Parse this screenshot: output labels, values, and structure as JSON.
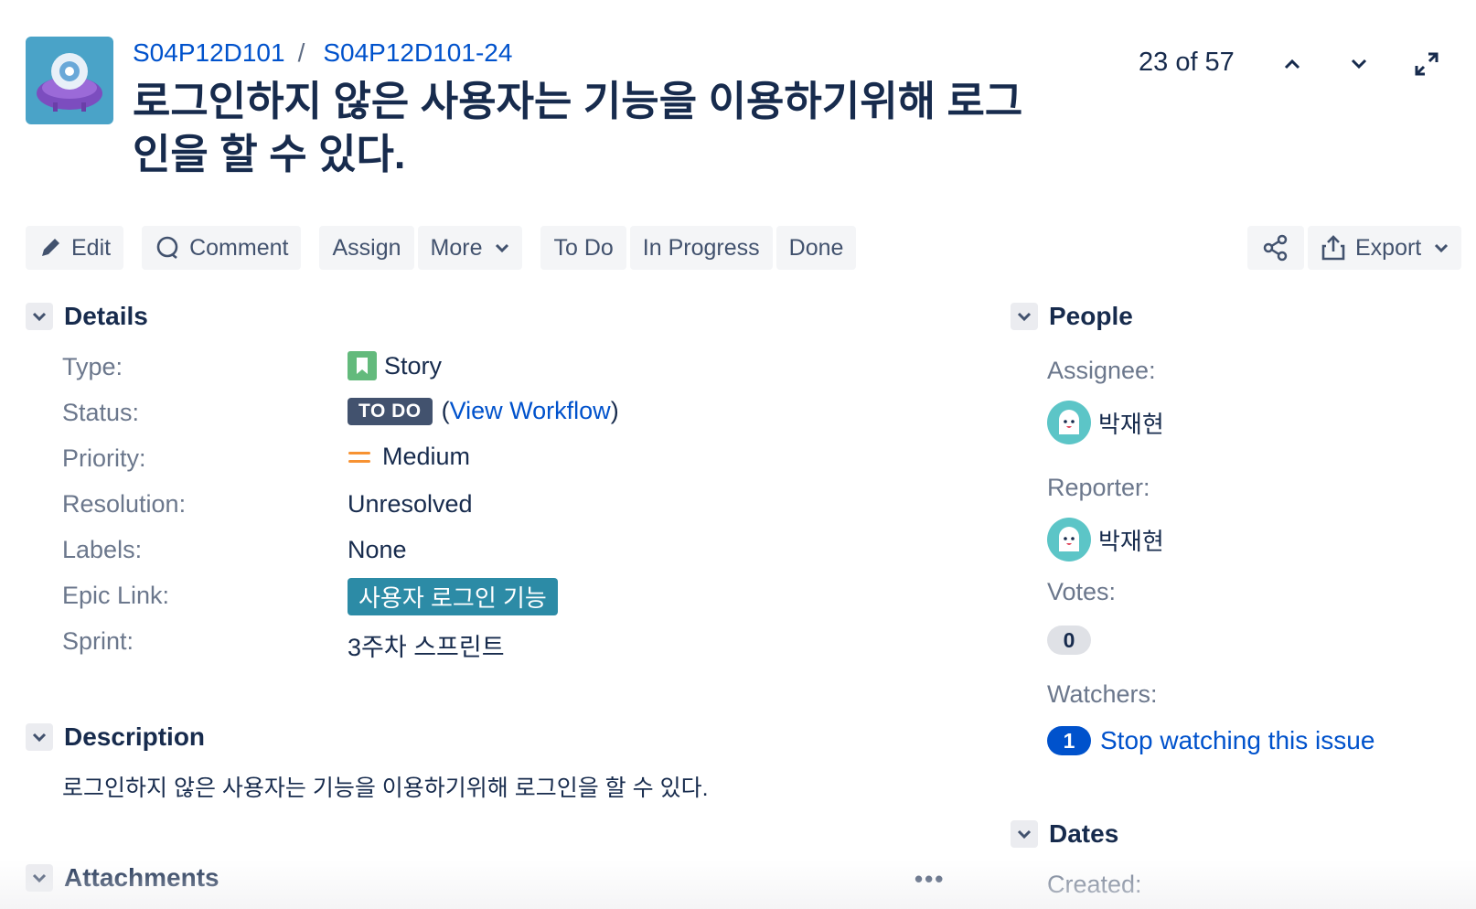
{
  "breadcrumb": {
    "project_key": "S04P12D101",
    "separator": "/",
    "issue_key": "S04P12D101-24"
  },
  "summary": "로그인하지 않은 사용자는 기능을 이용하기위해 로그인을 할 수 있다.",
  "pager": {
    "text": "23 of 57"
  },
  "toolbar": {
    "edit": "Edit",
    "comment": "Comment",
    "assign": "Assign",
    "more": "More",
    "todo": "To Do",
    "in_progress": "In Progress",
    "done": "Done",
    "export": "Export"
  },
  "details": {
    "heading": "Details",
    "fields": {
      "type": {
        "label": "Type:",
        "value": "Story"
      },
      "status": {
        "label": "Status:",
        "value": "TO DO",
        "open_paren": "(",
        "link": "View Workflow",
        "close_paren": ")"
      },
      "priority": {
        "label": "Priority:",
        "value": "Medium"
      },
      "resolution": {
        "label": "Resolution:",
        "value": "Unresolved"
      },
      "labels": {
        "label": "Labels:",
        "value": "None"
      },
      "epic_link": {
        "label": "Epic Link:",
        "value": "사용자 로그인 기능"
      },
      "sprint": {
        "label": "Sprint:",
        "value": "3주차 스프린트"
      }
    }
  },
  "description": {
    "heading": "Description",
    "text": "로그인하지 않은 사용자는 기능을 이용하기위해 로그인을 할 수 있다."
  },
  "attachments": {
    "heading": "Attachments",
    "more": "•••"
  },
  "people": {
    "heading": "People",
    "assignee_label": "Assignee:",
    "assignee": "박재현",
    "reporter_label": "Reporter:",
    "reporter": "박재현",
    "votes_label": "Votes:",
    "votes": "0",
    "watchers_label": "Watchers:",
    "watchers": "1",
    "watch_link": "Stop watching this issue"
  },
  "dates": {
    "heading": "Dates",
    "created_label": "Created:"
  },
  "colors": {
    "link": "#0052cc",
    "status_todo": "#42526e",
    "epic": "#2c8ba6",
    "story": "#63ba7c",
    "priority_medium": "#f79232"
  }
}
